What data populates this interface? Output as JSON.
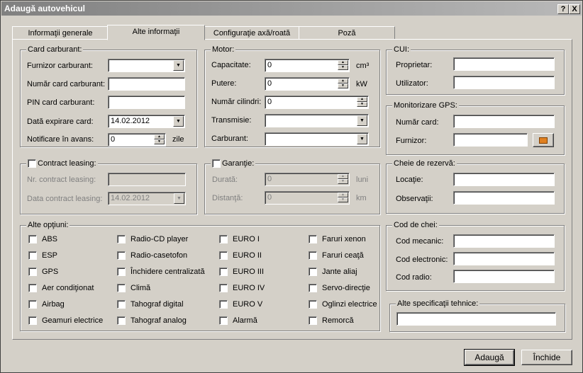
{
  "window": {
    "title": "Adaugă autovehicul",
    "help": "?",
    "close": "X"
  },
  "tabs": [
    "Informaţii generale",
    "Alte informaţii",
    "Configuraţie axă/roată",
    "Poză"
  ],
  "card": {
    "title": "Card carburant:",
    "supplier": "Furnizor carburant:",
    "number": "Număr card carburant:",
    "pin": "PIN card carburant:",
    "expiry": "Dată expirare card:",
    "expiry_value": "14.02.2012",
    "notice": "Notificare în avans:",
    "notice_value": "0",
    "notice_unit": "zile"
  },
  "motor": {
    "title": "Motor:",
    "capacity": "Capacitate:",
    "capacity_value": "0",
    "capacity_unit": "cm³",
    "power": "Putere:",
    "power_value": "0",
    "power_unit": "kW",
    "cylinders": "Număr cilindri:",
    "cylinders_value": "0",
    "transmission": "Transmisie:",
    "fuel": "Carburant:"
  },
  "cui": {
    "title": "CUI:",
    "owner": "Proprietar:",
    "user": "Utilizator:"
  },
  "gps": {
    "title": "Monitorizare GPS:",
    "card": "Număr card:",
    "supplier": "Furnizor:"
  },
  "leasing": {
    "title": "Contract leasing:",
    "number": "Nr. contract leasing:",
    "date": "Data contract leasing:",
    "date_value": "14.02.2012"
  },
  "warranty": {
    "title": "Garanţie:",
    "duration": "Durată:",
    "duration_value": "0",
    "duration_unit": "luni",
    "distance": "Distanţă:",
    "distance_value": "0",
    "distance_unit": "km"
  },
  "spare_key": {
    "title": "Cheie de rezervă:",
    "location": "Locaţie:",
    "notes": "Observaţii:"
  },
  "options": {
    "title": "Alte opţiuni:",
    "items": [
      [
        "ABS",
        "ESP",
        "GPS",
        "Aer condiţionat",
        "Airbag",
        "Geamuri electrice"
      ],
      [
        "Radio-CD player",
        "Radio-casetofon",
        "Închidere centralizată",
        "Climă",
        "Tahograf digital",
        "Tahograf analog"
      ],
      [
        "EURO I",
        "EURO II",
        "EURO III",
        "EURO IV",
        "EURO V",
        "Alarmă"
      ],
      [
        "Faruri xenon",
        "Faruri ceaţă",
        "Jante aliaj",
        "Servo-direcţie",
        "Oglinzi electrice",
        "Remorcă"
      ]
    ]
  },
  "key_codes": {
    "title": "Cod de chei:",
    "mechanical": "Cod mecanic:",
    "electronic": "Cod electronic:",
    "radio": "Cod radio:"
  },
  "tech": {
    "title": "Alte specificaţii tehnice:"
  },
  "buttons": {
    "add": "Adaugă",
    "close": "Închide"
  }
}
